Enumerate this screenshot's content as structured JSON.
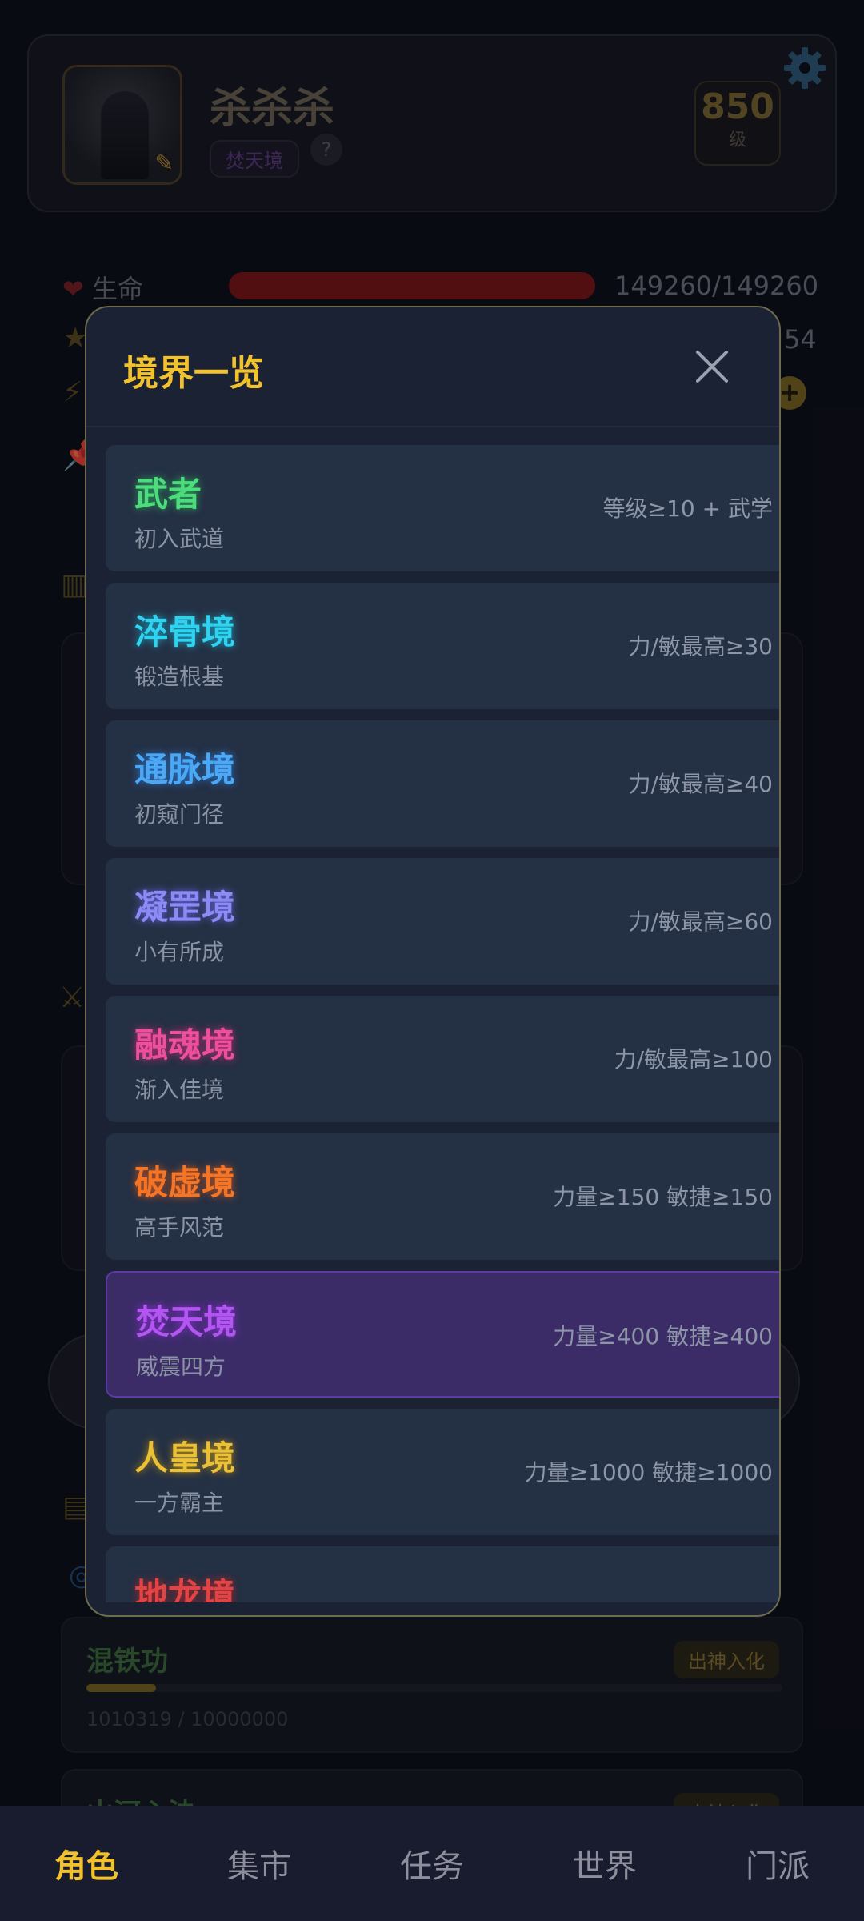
{
  "profile": {
    "name": "杀杀杀",
    "realm_badge": "焚天境",
    "help_label": "?",
    "level": "850",
    "level_unit": "级"
  },
  "stats": {
    "hp_label": "生命",
    "hp_value": "149260/149260",
    "hp_fraction": 1.0,
    "secondary_value": "54"
  },
  "skills": [
    {
      "name": "混铁功",
      "tag": "出神入化",
      "progress": "1010319 / 10000000",
      "fraction": 0.1
    },
    {
      "name": "山河心法",
      "tag": "出神入化"
    }
  ],
  "modal": {
    "title": "境界一览",
    "realms": [
      {
        "name": "武者",
        "desc": "初入武道",
        "req": "等级≥10 + 武学",
        "color": "#4ddc7c",
        "glow": "#2aa85a"
      },
      {
        "name": "淬骨境",
        "desc": "锻造根基",
        "req": "力/敏最高≥30",
        "color": "#2fd3f0",
        "glow": "#1aa6c4"
      },
      {
        "name": "通脉境",
        "desc": "初窥门径",
        "req": "力/敏最高≥40",
        "color": "#4aa8f7",
        "glow": "#2a7ad0"
      },
      {
        "name": "凝罡境",
        "desc": "小有所成",
        "req": "力/敏最高≥60",
        "color": "#8c8af5",
        "glow": "#6660d8"
      },
      {
        "name": "融魂境",
        "desc": "渐入佳境",
        "req": "力/敏最高≥100",
        "color": "#ec4f9c",
        "glow": "#c22c76"
      },
      {
        "name": "破虚境",
        "desc": "高手风范",
        "req": "力量≥150 敏捷≥150",
        "color": "#f57527",
        "glow": "#c9521a"
      },
      {
        "name": "焚天境",
        "desc": "威震四方",
        "req": "力量≥400 敏捷≥400",
        "color": "#b355f0",
        "glow": "#8a2ed0",
        "current": true
      },
      {
        "name": "人皇境",
        "desc": "一方霸主",
        "req": "力量≥1000 敏捷≥1000",
        "color": "#eac036",
        "glow": "#b38a1a"
      },
      {
        "name": "地龙境",
        "desc": "",
        "req": "",
        "color": "#e04444",
        "glow": "#b02222"
      }
    ]
  },
  "nav": [
    {
      "label": "角色",
      "active": true
    },
    {
      "label": "集市"
    },
    {
      "label": "任务"
    },
    {
      "label": "世界"
    },
    {
      "label": "门派"
    }
  ],
  "colors": {
    "accent": "#f2c12e",
    "modal_bg": "#1b2233",
    "item_bg": "#243044",
    "current_bg": "#3b2c68"
  }
}
